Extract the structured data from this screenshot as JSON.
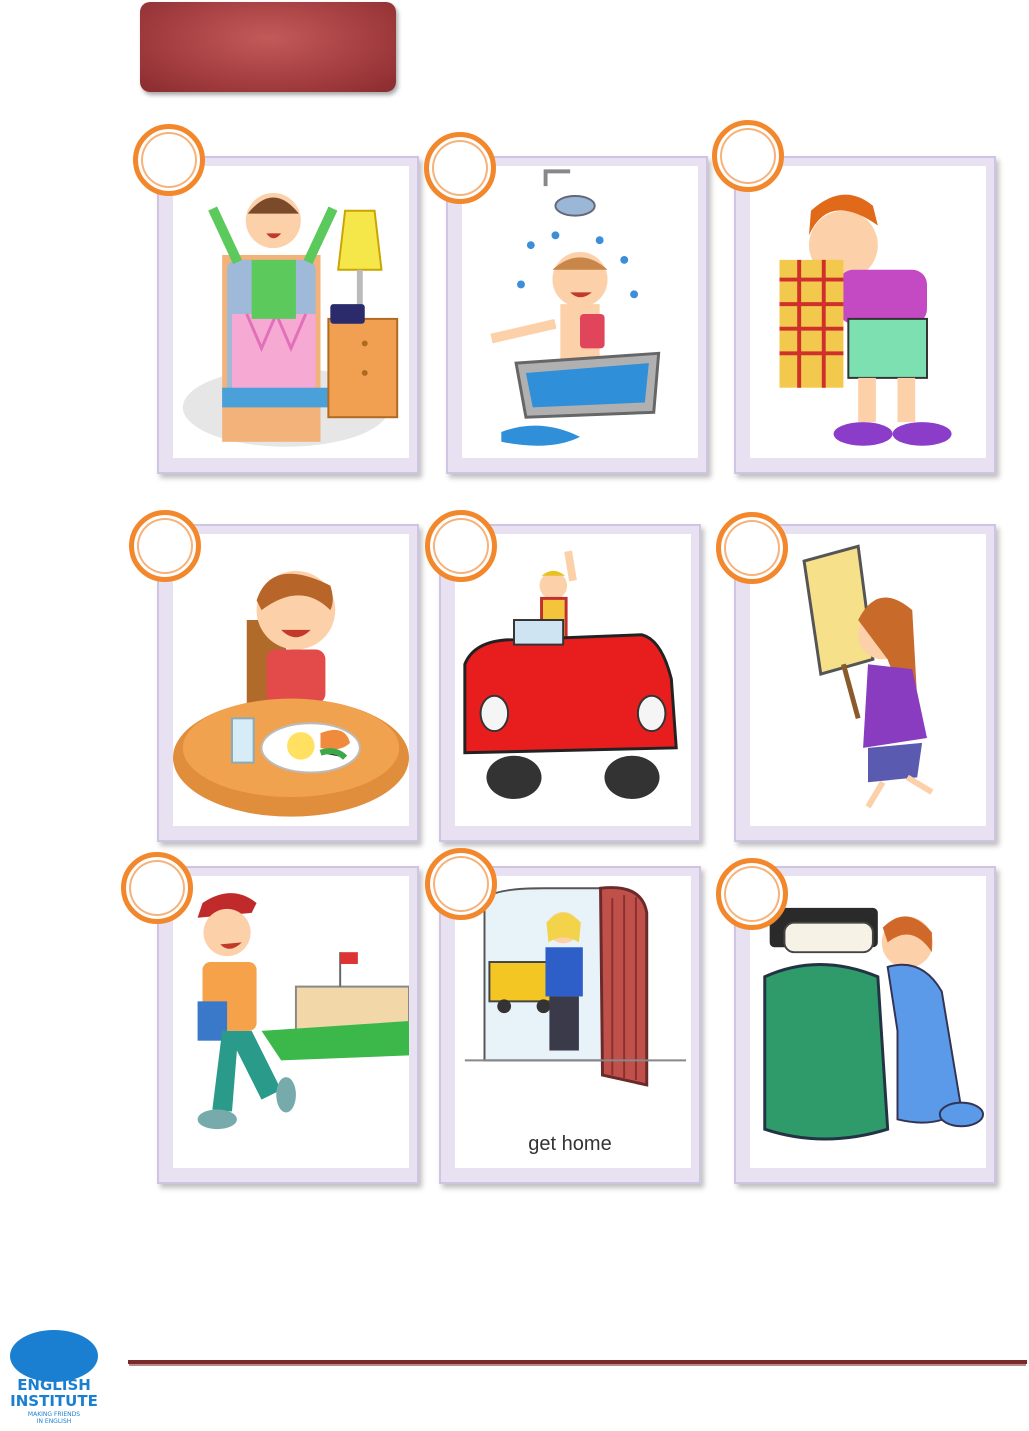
{
  "cards": [
    {
      "scene": "wake up boy stretching in bed"
    },
    {
      "scene": "boy taking a shower in bathtub"
    },
    {
      "scene": "boy getting dressed"
    },
    {
      "scene": "boy eating breakfast"
    },
    {
      "scene": "man driving red car"
    },
    {
      "scene": "woman holding quit sign"
    },
    {
      "scene": "boy walking to school"
    },
    {
      "scene": "girl arriving home",
      "caption": "get home"
    },
    {
      "scene": "child praying by bed"
    }
  ],
  "colors": {
    "banner": "#a63f41",
    "badge_ring": "#f3872c",
    "card_frame": "#e7e1f1",
    "footer_rule": "#7a2a2a",
    "logo_blue": "#1a7fd0"
  }
}
